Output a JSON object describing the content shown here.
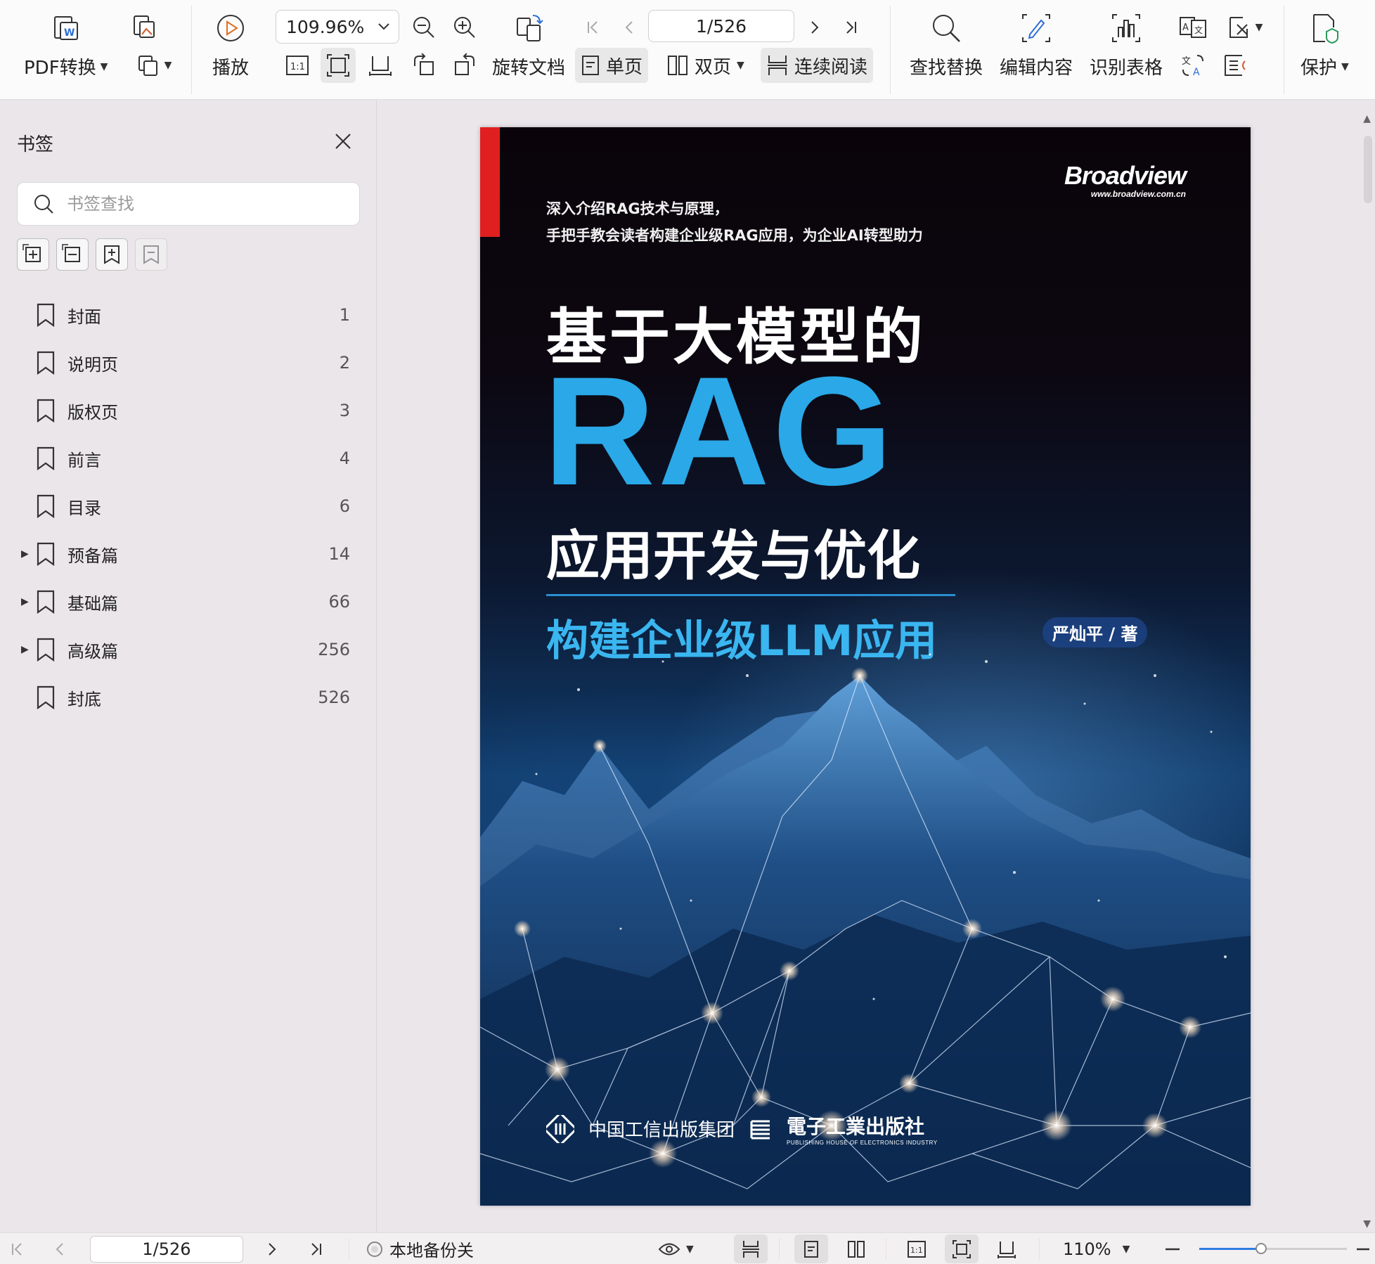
{
  "toolbar": {
    "pdf_convert": "PDF转换",
    "play": "播放",
    "zoom_value": "109.96%",
    "page_indicator": "1/526",
    "rotate_doc": "旋转文档",
    "single_page": "单页",
    "double_page": "双页",
    "continuous_read": "连续阅读",
    "find_replace": "查找替换",
    "edit_content": "编辑内容",
    "recognize_table": "识别表格",
    "protect": "保护"
  },
  "sidebar": {
    "title": "书签",
    "search_placeholder": "书签查找",
    "items": [
      {
        "label": "封面",
        "page": "1",
        "expandable": false
      },
      {
        "label": "说明页",
        "page": "2",
        "expandable": false
      },
      {
        "label": "版权页",
        "page": "3",
        "expandable": false
      },
      {
        "label": "前言",
        "page": "4",
        "expandable": false
      },
      {
        "label": "目录",
        "page": "6",
        "expandable": false
      },
      {
        "label": "预备篇",
        "page": "14",
        "expandable": true
      },
      {
        "label": "基础篇",
        "page": "66",
        "expandable": true
      },
      {
        "label": "高级篇",
        "page": "256",
        "expandable": true
      },
      {
        "label": "封底",
        "page": "526",
        "expandable": false
      }
    ]
  },
  "cover": {
    "subtitle_line1": "深入介绍RAG技术与原理，",
    "subtitle_line2": "手把手教会读者构建企业级RAG应用，为企业AI转型助力",
    "brand": "Broadview",
    "brand_url": "www.broadview.com.cn",
    "title_line1": "基于大模型的",
    "title_rag": "RAG",
    "title_line2": "应用开发与优化",
    "title_line3": "构建企业级LLM应用",
    "author": "严灿平 / 著",
    "publisher1": "中国工信出版集团",
    "publisher2": "電子工業出版社",
    "publisher2_en": "PUBLISHING HOUSE OF ELECTRONICS INDUSTRY",
    "accent_red": "#e02020",
    "accent_blue": "#2aa8e8"
  },
  "statusbar": {
    "page_indicator": "1/526",
    "backup_label": "本地备份关",
    "zoom_value": "110%",
    "zoom_slider_fraction": 0.42
  }
}
